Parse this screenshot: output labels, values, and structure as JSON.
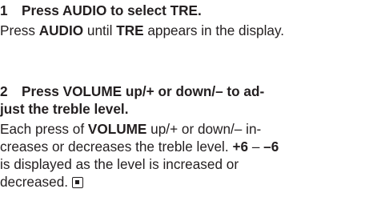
{
  "steps": [
    {
      "number": "1",
      "title": "Press AUDIO to select TRE.",
      "body": {
        "p1": "Press ",
        "b1": "AUDIO",
        "p2": " until ",
        "b2": "TRE",
        "p3": " appears in the display."
      }
    },
    {
      "number": "2",
      "title_line1": "Press VOLUME up/+ or down/– to ad-",
      "title_line2": "just the treble level.",
      "body": {
        "l1_p1": "Each press of ",
        "l1_b1": "VOLUME",
        "l1_p2": " up/+ or down/– in-",
        "l2_p1": "creases or decreases the treble level. ",
        "l2_b1": "+6",
        "l2_p2": " – ",
        "l2_b2": "–6",
        "l3": "is displayed as the level is increased or",
        "l4": "decreased."
      }
    }
  ],
  "end_mark_icon": "end-of-section-mark"
}
